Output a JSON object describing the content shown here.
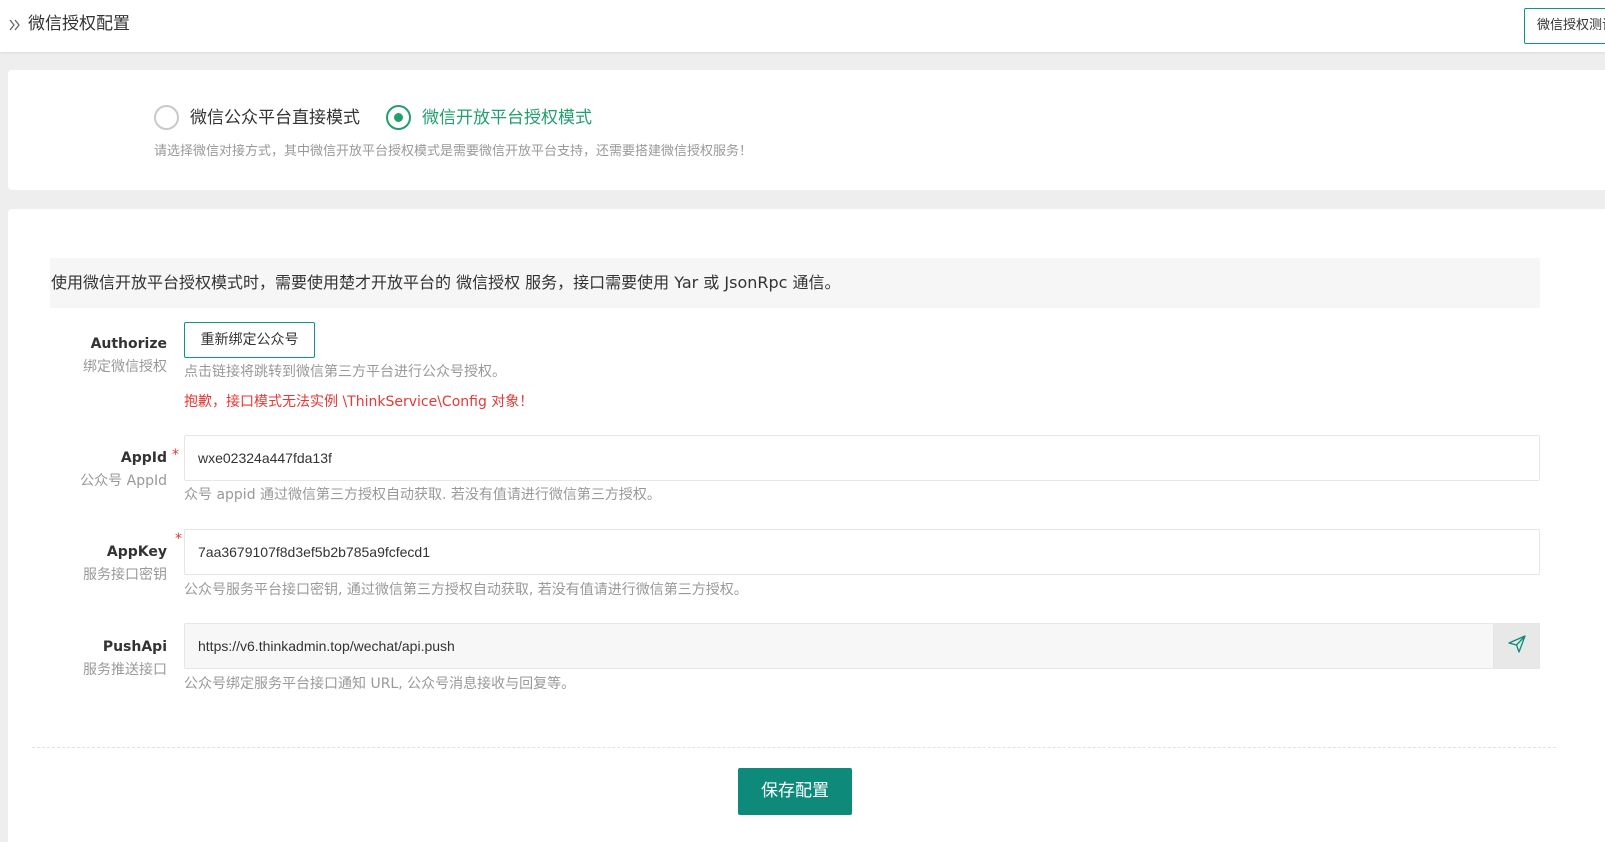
{
  "header": {
    "title": "微信授权配置",
    "right_button": "微信授权测试"
  },
  "mode": {
    "options": [
      {
        "label": "微信公众平台直接模式",
        "checked": false
      },
      {
        "label": "微信开放平台授权模式",
        "checked": true
      }
    ],
    "help": "请选择微信对接方式，其中微信开放平台授权模式是需要微信开放平台支持，还需要搭建微信授权服务！"
  },
  "notice": "使用微信开放平台授权模式时，需要使用楚才开放平台的 微信授权 服务，接口需要使用 Yar 或 JsonRpc 通信。",
  "authorize": {
    "label": "Authorize",
    "sublabel": "绑定微信授权",
    "button": "重新绑定公众号",
    "help": "点击链接将跳转到微信第三方平台进行公众号授权。",
    "error": "抱歉，接口模式无法实例 \\ThinkService\\Config 对象！"
  },
  "appid": {
    "label": "AppId",
    "sublabel": "公众号 AppId",
    "required": "*",
    "value": "wxe02324a447fda13f",
    "help": "众号 appid 通过微信第三方授权自动获取. 若没有值请进行微信第三方授权。"
  },
  "appkey": {
    "label": "AppKey",
    "sublabel": "服务接口密钥",
    "required": "*",
    "value": "7aa3679107f8d3ef5b2b785a9fcfecd1",
    "help": "公众号服务平台接口密钥, 通过微信第三方授权自动获取, 若没有值请进行微信第三方授权。"
  },
  "pushapi": {
    "label": "PushApi",
    "sublabel": "服务推送接口",
    "value": "https://v6.thinkadmin.top/wechat/api.push",
    "help": "公众号绑定服务平台接口通知 URL, 公众号消息接收与回复等。",
    "icon": "send-icon"
  },
  "save_button": "保存配置",
  "colors": {
    "accent": "#0d8a7a",
    "radio_checked": "#22a06b",
    "error": "#e53935"
  }
}
